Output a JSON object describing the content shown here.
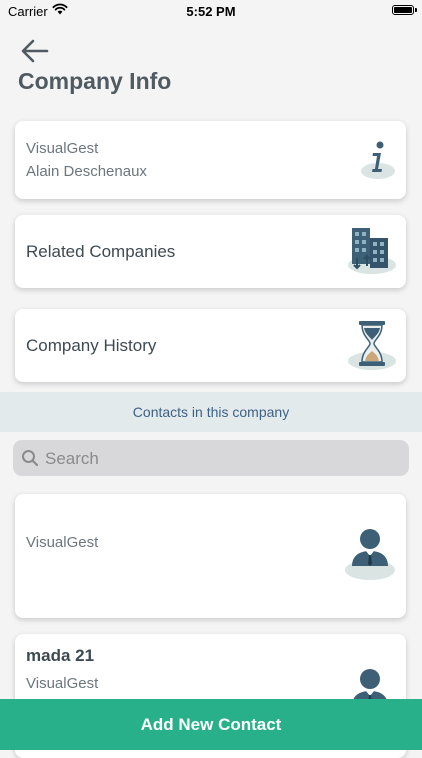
{
  "status_bar": {
    "carrier": "Carrier",
    "time": "5:52 PM"
  },
  "header": {
    "title": "Company Info",
    "back_icon": "arrow-left-icon"
  },
  "company_card": {
    "company_name": "VisualGest",
    "contact_name": "Alain Deschenaux",
    "icon": "info-icon"
  },
  "related_card": {
    "label": "Related Companies",
    "icon": "buildings-icon"
  },
  "history_card": {
    "label": "Company History",
    "icon": "hourglass-icon"
  },
  "contacts_section": {
    "title": "Contacts in this company"
  },
  "search": {
    "placeholder": "Search",
    "value": ""
  },
  "contacts": [
    {
      "name": "",
      "company": "VisualGest",
      "icon": "person-icon"
    },
    {
      "name": "mada 21",
      "company": "VisualGest",
      "icon": "person-icon"
    }
  ],
  "footer": {
    "add_contact_label": "Add New Contact"
  },
  "colors": {
    "accent_green": "#28b08a",
    "banner_bg": "#e3eaeb",
    "banner_text": "#3e6187",
    "icon_dark": "#3d6077",
    "icon_shadow": "#d9e4e3"
  }
}
